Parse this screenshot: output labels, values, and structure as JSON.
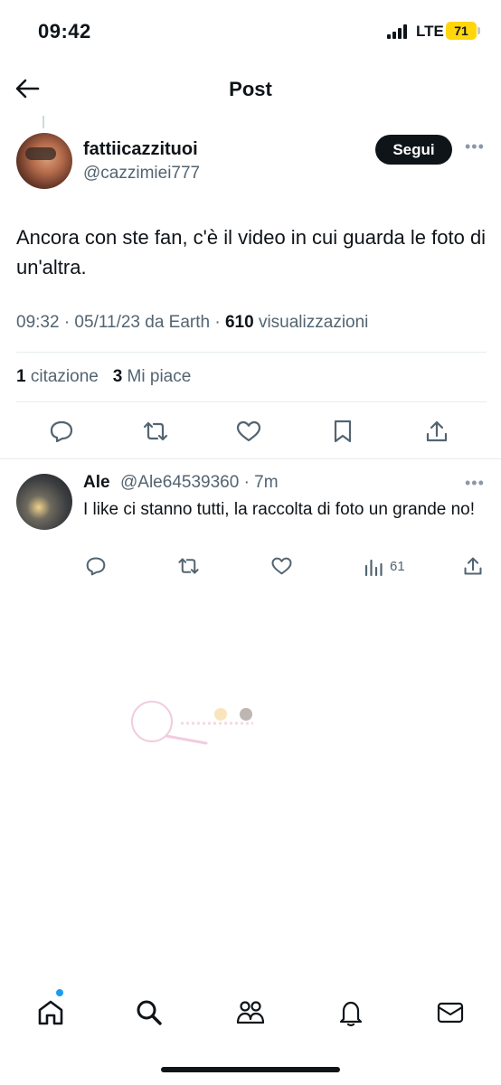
{
  "status_bar": {
    "time": "09:42",
    "network": "LTE",
    "battery": "71"
  },
  "header": {
    "title": "Post",
    "back_icon": "arrow-left-icon"
  },
  "post": {
    "author_name": "fattiicazzituoi",
    "author_handle": "@cazzimiei777",
    "follow_label": "Segui",
    "text": "Ancora con ste fan, c'è il video in cui guarda le foto di un'altra.",
    "meta_prefix": "09:32 · 05/11/23 da Earth · ",
    "views_count": "610",
    "views_label": " visualizzazioni",
    "quotes_count": "1",
    "quotes_label": " citazione",
    "likes_count": "3",
    "likes_label": " Mi piace",
    "actions": [
      "reply-icon",
      "retweet-icon",
      "like-icon",
      "bookmark-icon",
      "share-icon"
    ]
  },
  "reply": {
    "name": "Ale",
    "handle_time": "@Ale64539360 · 7m",
    "text": "I like ci stanno tutti, la raccolta di foto un grande no!",
    "views": "61",
    "actions": [
      "reply-icon",
      "retweet-icon",
      "like-icon",
      "views-icon",
      "share-icon"
    ]
  },
  "nav": {
    "items": [
      "home-icon",
      "search-icon",
      "communities-icon",
      "notifications-icon",
      "messages-icon"
    ]
  },
  "colors": {
    "text": "#0f1419",
    "secondary": "#536471",
    "accent": "#1d9bf0",
    "battery": "#ffd60a"
  }
}
